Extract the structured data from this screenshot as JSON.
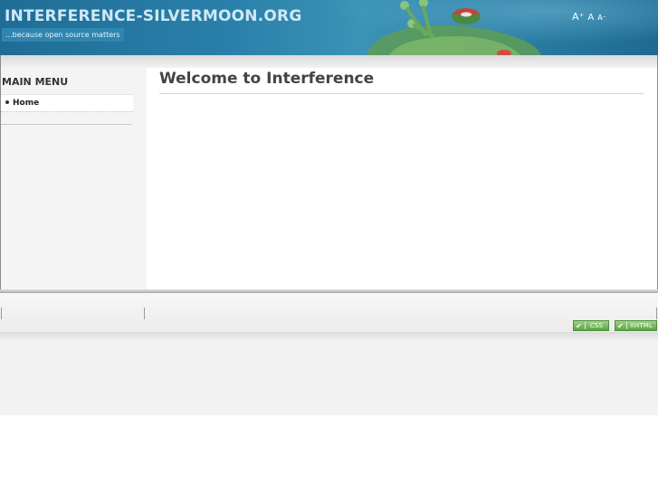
{
  "header": {
    "site_title": "INTERFERENCE-SILVERMOON.ORG",
    "tagline": "...because open source matters",
    "font_controls": {
      "increase": "A⁺",
      "default": "A",
      "decrease": "A⁻"
    }
  },
  "sidebar": {
    "menu_title": "MAIN MENU",
    "items": [
      {
        "label": "Home"
      }
    ]
  },
  "main": {
    "title": "Welcome to Interference"
  },
  "footer": {
    "badges": [
      {
        "label": "CSS"
      },
      {
        "label": "XHTML"
      }
    ]
  }
}
